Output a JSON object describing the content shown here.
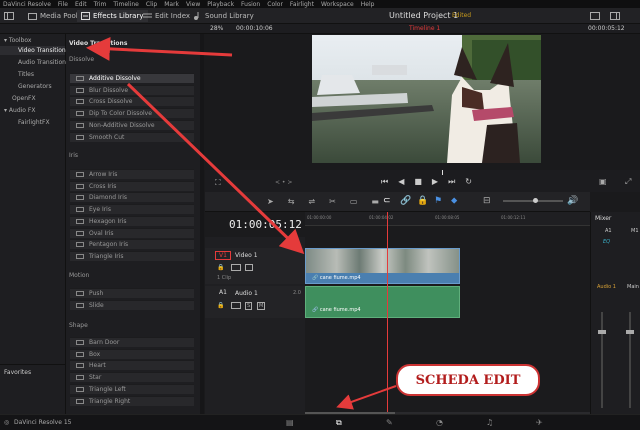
{
  "menu": [
    "DaVinci Resolve",
    "File",
    "Edit",
    "Trim",
    "Timeline",
    "Clip",
    "Mark",
    "View",
    "Playback",
    "Fusion",
    "Color",
    "Fairlight",
    "Workspace",
    "Help"
  ],
  "toolbar": {
    "media_pool": "Media Pool",
    "effects_library": "Effects Library",
    "edit_index": "Edit Index",
    "sound_library": "Sound Library",
    "project_title": "Untitled Project 1",
    "edited": "Edited"
  },
  "viewer_bar": {
    "zoom": "28%",
    "source_tc": "00:00:10:06",
    "timeline_name": "Timeline 1",
    "record_tc": "00:00:05:12"
  },
  "tree": {
    "toolbox": "Toolbox",
    "video_transitions": "Video Transitions",
    "audio_transitions": "Audio Transitions",
    "titles": "Titles",
    "generators": "Generators",
    "openfx": "OpenFX",
    "audio_fx": "Audio FX",
    "fairlightfx": "FairlightFX",
    "favorites": "Favorites"
  },
  "fx": {
    "header": "Video Transitions",
    "dissolve_title": "Dissolve",
    "dissolve": [
      "Additive Dissolve",
      "Blur Dissolve",
      "Cross Dissolve",
      "Dip To Color Dissolve",
      "Non-Additive Dissolve",
      "Smooth Cut"
    ],
    "iris_title": "Iris",
    "iris": [
      "Arrow Iris",
      "Cross Iris",
      "Diamond Iris",
      "Eye Iris",
      "Hexagon Iris",
      "Oval Iris",
      "Pentagon Iris",
      "Triangle Iris"
    ],
    "motion_title": "Motion",
    "motion": [
      "Push",
      "Slide"
    ],
    "shape_title": "Shape",
    "shape": [
      "Barn Door",
      "Box",
      "Heart",
      "Star",
      "Triangle Left",
      "Triangle Right"
    ]
  },
  "timeline": {
    "timecode": "01:00:05:12",
    "ruler": [
      "01:00:00:00",
      "01:00:04:02",
      "01:00:08:05",
      "01:00:12:11"
    ],
    "v1_tag": "V1",
    "v1_name": "Video 1",
    "v1_clips": "1 Clip",
    "a1_tag": "A1",
    "a1_name": "Audio 1",
    "a1_level": "2.0",
    "video_clip": "cane fiume.mp4",
    "audio_clip": "cane fiume.mp4"
  },
  "mixer": {
    "title": "Mixer",
    "a1": "A1",
    "m1": "M1",
    "eq": "EQ",
    "audio1": "Audio 1",
    "main": "Main"
  },
  "footer": {
    "app": "DaVinci Resolve 15"
  },
  "callout": "SCHEDA EDIT",
  "colors": {
    "accent_red": "#e53b3b",
    "clip_blue": "#4a7fb0",
    "clip_green": "#3f8f5e",
    "edited": "#c79a1c"
  }
}
